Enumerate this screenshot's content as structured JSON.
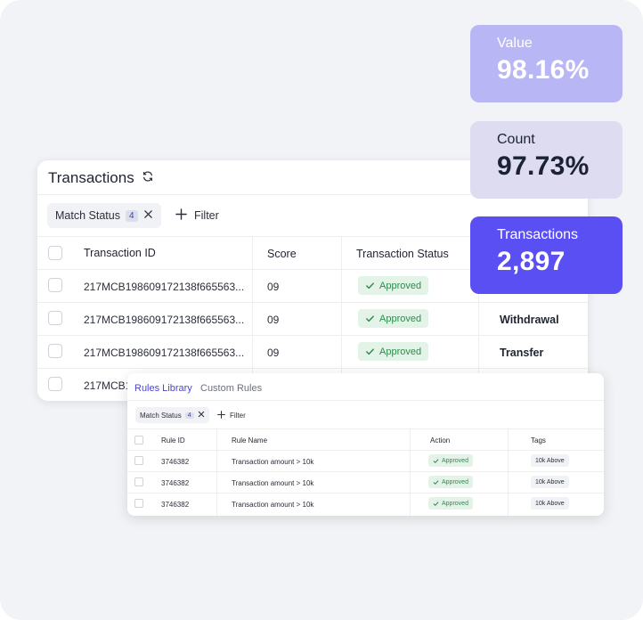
{
  "transactions_card": {
    "title": "Transactions",
    "refresh_icon": "refresh-icon",
    "filter_chip": {
      "label": "Match Status",
      "count": "4"
    },
    "filter_button": "Filter",
    "columns": [
      "Transaction ID",
      "Score",
      "Transaction Status"
    ],
    "rows": [
      {
        "id": "217MCB198609172138f665563...",
        "score": "09",
        "status": "Approved",
        "type": ""
      },
      {
        "id": "217MCB198609172138f665563...",
        "score": "09",
        "status": "Approved",
        "type": "Withdrawal"
      },
      {
        "id": "217MCB198609172138f665563...",
        "score": "09",
        "status": "Approved",
        "type": "Transfer"
      },
      {
        "id": "217MCB1",
        "score": "",
        "status": "",
        "type": ""
      }
    ]
  },
  "stats": [
    {
      "label": "Value",
      "value": "98.16%"
    },
    {
      "label": "Count",
      "value": "97.73%"
    },
    {
      "label": "Transactions",
      "value": "2,897"
    }
  ],
  "rules_card": {
    "tabs": [
      "Rules Library",
      "Custom Rules"
    ],
    "filter_chip": {
      "label": "Match Status",
      "count": "4"
    },
    "filter_button": "Filter",
    "columns": [
      "Rule ID",
      "Rule Name",
      "Action",
      "Tags"
    ],
    "rows": [
      {
        "id": "3746382",
        "name": "Transaction amount > 10k",
        "action": "Approved",
        "tag": "10k Above"
      },
      {
        "id": "3746382",
        "name": "Transaction amount > 10k",
        "action": "Approved",
        "tag": "10k Above"
      },
      {
        "id": "3746382",
        "name": "Transaction amount > 10k",
        "action": "Approved",
        "tag": "10k Above"
      }
    ]
  },
  "colors": {
    "accent": "#5a4ff3",
    "accent_light": "#b9b6f6",
    "approved_bg": "#e3f3e8",
    "approved_text": "#2f8a4e"
  }
}
